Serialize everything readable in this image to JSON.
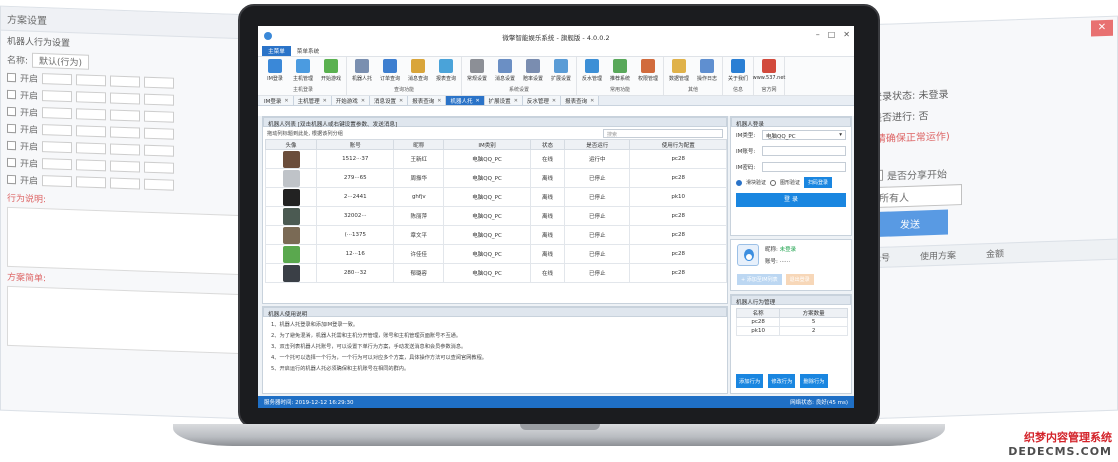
{
  "bg_left": {
    "title": "方案设置",
    "section": "机器人行为设置",
    "name_label": "名称:",
    "name_value": "默认(行为)",
    "rows": [
      "开启",
      "开启",
      "开启",
      "开启",
      "开启",
      "开启",
      "开启"
    ],
    "rule_label": "行为说明:",
    "rule_label2": "方案简单:"
  },
  "bg_right": {
    "state_label": "登录状态: 未登录",
    "state2": "是否进行: 否",
    "warn": "(请确保正常运作)",
    "check": "是否分享开始",
    "sel": "所有人",
    "btn": "发送",
    "col1": "帐号",
    "col2": "使用方案",
    "col3": "金额"
  },
  "app": {
    "title": "微擎智能娱乐系统 - 旗舰版 - 4.0.0.2",
    "ribbon_tabs": [
      "主菜单",
      "菜单系统"
    ],
    "ribbon_groups": [
      {
        "label": "主机登录",
        "items": [
          {
            "label": "IM登录",
            "color": "#3a88d8"
          },
          {
            "label": "主机管理",
            "color": "#4b9be0"
          },
          {
            "label": "开始游戏",
            "color": "#5ab150"
          }
        ]
      },
      {
        "label": "查询功能",
        "items": [
          {
            "label": "机器人托",
            "color": "#7a8fb0"
          },
          {
            "label": "订单查询",
            "color": "#3e7fd0"
          },
          {
            "label": "消息查询",
            "color": "#d9a53a"
          },
          {
            "label": "报表查询",
            "color": "#4aa3d9"
          }
        ]
      },
      {
        "label": "系统设置",
        "items": [
          {
            "label": "常规设置",
            "color": "#8c8f96"
          },
          {
            "label": "消息设置",
            "color": "#6b8fc4"
          },
          {
            "label": "赔率设置",
            "color": "#7a8db0"
          },
          {
            "label": "扩展设置",
            "color": "#5a9cd6"
          }
        ]
      },
      {
        "label": "常用功能",
        "items": [
          {
            "label": "反水管理",
            "color": "#3c8fd6"
          },
          {
            "label": "推荐系统",
            "color": "#59a85a"
          },
          {
            "label": "权限管理",
            "color": "#d16b3d"
          }
        ]
      },
      {
        "label": "其他",
        "items": [
          {
            "label": "数据管理",
            "color": "#e0b24a"
          },
          {
            "label": "操作日志",
            "color": "#5f8fd0"
          }
        ]
      },
      {
        "label": "信息",
        "items": [
          {
            "label": "关于我们",
            "color": "#2a7fd4"
          }
        ]
      },
      {
        "label": "官方网",
        "items": [
          {
            "label": "www.537.net",
            "color": "#d24a3c"
          }
        ]
      }
    ],
    "doc_tabs": [
      "IM登录",
      "主机管理",
      "开始游戏",
      "消息设置",
      "报表查询",
      "机器人托",
      "扩展设置",
      "反水管理",
      "报表查询"
    ],
    "active_doc_tab": 5,
    "list_header": "机器人列表 [双击机器人或右键设置参数、发送消息]",
    "hint": "拖动列标题到此处, 根据该列分组",
    "search_placeholder": "搜索",
    "columns": [
      "头像",
      "账号",
      "昵称",
      "IM类别",
      "状态",
      "是否运行",
      "使用行为配置"
    ],
    "rows": [
      {
        "account": "1512···37",
        "nick": "王新红",
        "im": "电脑QQ_PC",
        "state": "在线",
        "state_color": "green",
        "run": "运行中",
        "run_color": "green",
        "cfg": "pc28",
        "av": "#6b4d3b"
      },
      {
        "account": "279···65",
        "nick": "周振华",
        "im": "电脑QQ_PC",
        "state": "离线",
        "state_color": "red",
        "run": "已停止",
        "run_color": "red",
        "cfg": "pc28",
        "av": "#bfc3c8"
      },
      {
        "account": "2···2441",
        "nick": "ghfjv",
        "im": "电脑QQ_PC",
        "state": "离线",
        "state_color": "red",
        "run": "已停止",
        "run_color": "red",
        "cfg": "pk10",
        "av": "#222222"
      },
      {
        "account": "32002···",
        "nick": "陈丽萍",
        "im": "电脑QQ_PC",
        "state": "离线",
        "state_color": "red",
        "run": "已停止",
        "run_color": "red",
        "cfg": "pc28",
        "av": "#4b5a52"
      },
      {
        "account": "(···1375",
        "nick": "章文平",
        "im": "电脑QQ_PC",
        "state": "离线",
        "state_color": "red",
        "run": "已停止",
        "run_color": "red",
        "cfg": "pc28",
        "av": "#7a6a55"
      },
      {
        "account": "12···16",
        "nick": "许佳佳",
        "im": "电脑QQ_PC",
        "state": "离线",
        "state_color": "red",
        "run": "已停止",
        "run_color": "red",
        "cfg": "pc28",
        "av": "#5aa84e"
      },
      {
        "account": "280···32",
        "nick": "郁璐容",
        "im": "电脑QQ_PC",
        "state": "在线",
        "state_color": "green",
        "run": "已停止",
        "run_color": "red",
        "cfg": "pc28",
        "av": "#3a3f46"
      }
    ],
    "help_header": "机器人使用说明",
    "help": [
      "1、机器人托登录和添加IM登录一致。",
      "2、为了避免混淆，机器人托需和主机分开管理，账号和主机管理页面账号不互通。",
      "3、双击列表机器人托账号，可以设置下单行为方案，手动发送消息和会员参数消息。",
      "4、一个托可以选择一个行为，一个行为可以对应多个方案，具体操作方法可以查阅官网教程。",
      "5、开启运行的机器人托必须确保和主机账号在相同的群内。"
    ],
    "login": {
      "header": "机器人登录",
      "im_label": "IM类型:",
      "im_value": "电脑QQ_PC",
      "acc_label": "IM账号:",
      "pwd_label": "IM密码:",
      "radio1": "滑块验证",
      "radio2": "图形验证",
      "scan": "扫码登录",
      "login_btn": "登 录"
    },
    "account": {
      "nick_label": "昵称:",
      "nick_value": "未登录",
      "acc_label": "账号:",
      "acc_value": "······",
      "btn_add": "+ 添加至IM列表",
      "btn_exit": "退出登录"
    },
    "behavior": {
      "header": "机器人行为管理",
      "columns": [
        "名称",
        "方案数量"
      ],
      "rows": [
        {
          "name": "pc28",
          "count": "5"
        },
        {
          "name": "pk10",
          "count": "2"
        }
      ],
      "btn_add": "添加行为",
      "btn_edit": "修改行为",
      "btn_del": "删除行为"
    },
    "status": {
      "time": "服务器时间: 2019-12-12 16:29:30",
      "net": "网络状态: 良好(45 ms)"
    }
  },
  "watermark": {
    "line1": "织梦内容管理系统",
    "line2": "DEDECMS.COM"
  }
}
